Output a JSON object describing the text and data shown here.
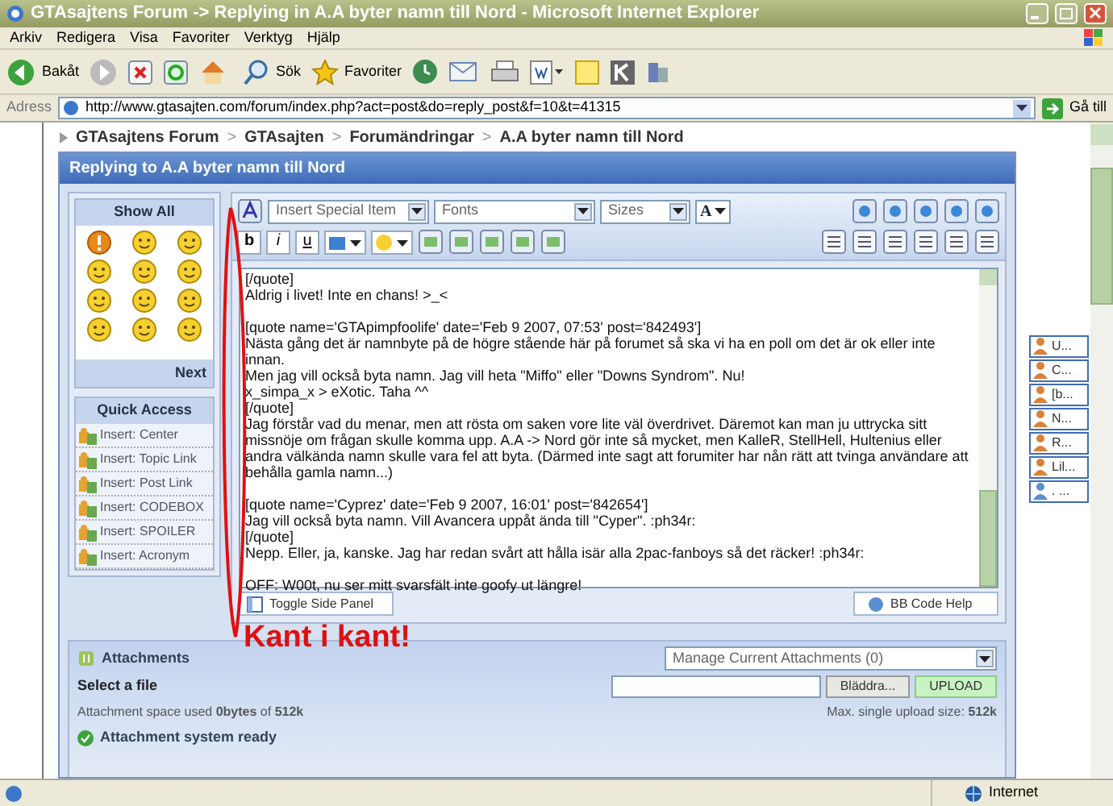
{
  "window": {
    "title": "GTAsajtens Forum -> Replying in A.A byter namn till Nord - Microsoft Internet Explorer"
  },
  "menu": [
    "Arkiv",
    "Redigera",
    "Visa",
    "Favoriter",
    "Verktyg",
    "Hjälp"
  ],
  "toolbar": {
    "back": "Bakåt",
    "search": "Sök",
    "favorites": "Favoriter"
  },
  "address": {
    "label": "Adress",
    "url": "http://www.gtasajten.com/forum/index.php?act=post&do=reply_post&f=10&t=41315",
    "go": "Gå till"
  },
  "breadcrumb": [
    {
      "label": "GTAsajtens Forum"
    },
    {
      "separator": ">",
      "label": "GTAsajten"
    },
    {
      "separator": ">",
      "label": "Forumändringar"
    },
    {
      "separator": ">",
      "label": "A.A byter namn till Nord"
    }
  ],
  "panel_title": "Replying to A.A byter namn till Nord",
  "side_panel": {
    "emoticons_title": "Show All",
    "next": "Next",
    "quick_access_title": "Quick Access",
    "quick_access": [
      "Insert: Center",
      "Insert: Topic Link",
      "Insert: Post Link",
      "Insert: CODEBOX",
      "Insert: SPOILER",
      "Insert: Acronym"
    ]
  },
  "editor": {
    "special_item": "Insert Special Item",
    "fonts": "Fonts",
    "sizes": "Sizes",
    "color_letter": "A",
    "format_buttons": [
      "b",
      "i",
      "u"
    ],
    "paragraphs": [
      [
        "[/quote]",
        "Aldrig i livet! Inte en chans!  >_<"
      ],
      [
        "[quote name='GTApimpfoolife' date='Feb 9 2007, 07:53' post='842493']",
        "Nästa gång det är namnbyte på de högre stående här på forumet så ska vi ha en poll om det är ok eller inte innan.",
        "Men jag vill också byta namn. Jag vill heta \"Miffo\" eller \"Downs Syndrom\". Nu!",
        "x_simpa_x > eXotic. Taha ^^",
        "[/quote]",
        "Jag förstår vad du menar, men att rösta om saken vore lite väl överdrivet. Däremot kan man ju uttrycka sitt missnöje om frågan skulle komma upp. A.A -> Nord gör inte så mycket, men KalleR, StellHell, Hultenius eller andra välkända namn skulle vara fel att byta. (Därmed inte sagt att forumiter har nån rätt att tvinga användare att behålla gamla namn...)"
      ],
      [
        "[quote name='Cyprez' date='Feb 9 2007, 16:01' post='842654']",
        "Jag vill också byta namn. Vill Avancera uppåt ända till \"Cyper\". :ph34r:",
        "[/quote]",
        "Nepp. Eller, ja, kanske. Jag har redan svårt att hålla isär alla 2pac-fanboys så det räcker!  :ph34r:"
      ],
      [
        "OFF: W00t, nu ser mitt svarsfält inte goofy ut längre!"
      ]
    ],
    "toggle_side_panel": "Toggle Side Panel",
    "bb_code_help": "BB Code Help"
  },
  "attachments": {
    "title": "Attachments",
    "manage": "Manage Current Attachments (0)",
    "select_label": "Select a file",
    "browse": "Bläddra...",
    "upload": "UPLOAD",
    "space_used": "Attachment space used **0bytes** of **512k**",
    "max_size": "Max. single upload size: **512k**",
    "status": "Attachment system ready"
  },
  "online_users": [
    "U...",
    "C...",
    "[b...",
    "N...",
    "R...",
    "Lil...",
    ". ..."
  ],
  "status_bar": {
    "zone": "Internet"
  },
  "annotation": {
    "text": "Kant i kant!"
  }
}
